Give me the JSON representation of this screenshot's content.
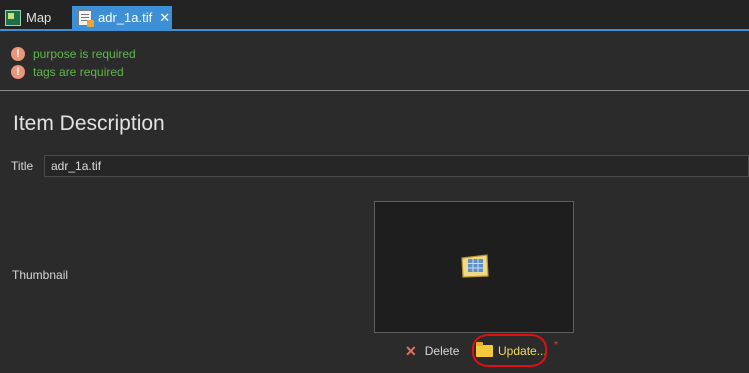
{
  "tabs": [
    {
      "label": "Map",
      "icon": "map-icon",
      "active": false
    },
    {
      "label": "adr_1a.tif",
      "icon": "metadata-document-icon",
      "active": true,
      "close_glyph": "✕"
    }
  ],
  "warnings": [
    {
      "icon": "error-icon",
      "glyph": "!",
      "text": "purpose is required"
    },
    {
      "icon": "error-icon",
      "glyph": "!",
      "text": "tags are required"
    }
  ],
  "section": {
    "title": "Item Description"
  },
  "fields": {
    "title": {
      "label": "Title",
      "value": "adr_1a.tif"
    },
    "thumbnail": {
      "label": "Thumbnail",
      "image_icon": "raster-image-icon",
      "delete": {
        "glyph": "✕",
        "label": "Delete"
      },
      "update": {
        "icon": "folder-icon",
        "label": "Update..."
      },
      "marker": "*"
    }
  },
  "colors": {
    "tab_active": "#3d8fd6",
    "warning_text": "#5fb84b",
    "error_icon": "#e9967a",
    "update_text": "#f0dc6a",
    "annotation": "#e01010"
  }
}
